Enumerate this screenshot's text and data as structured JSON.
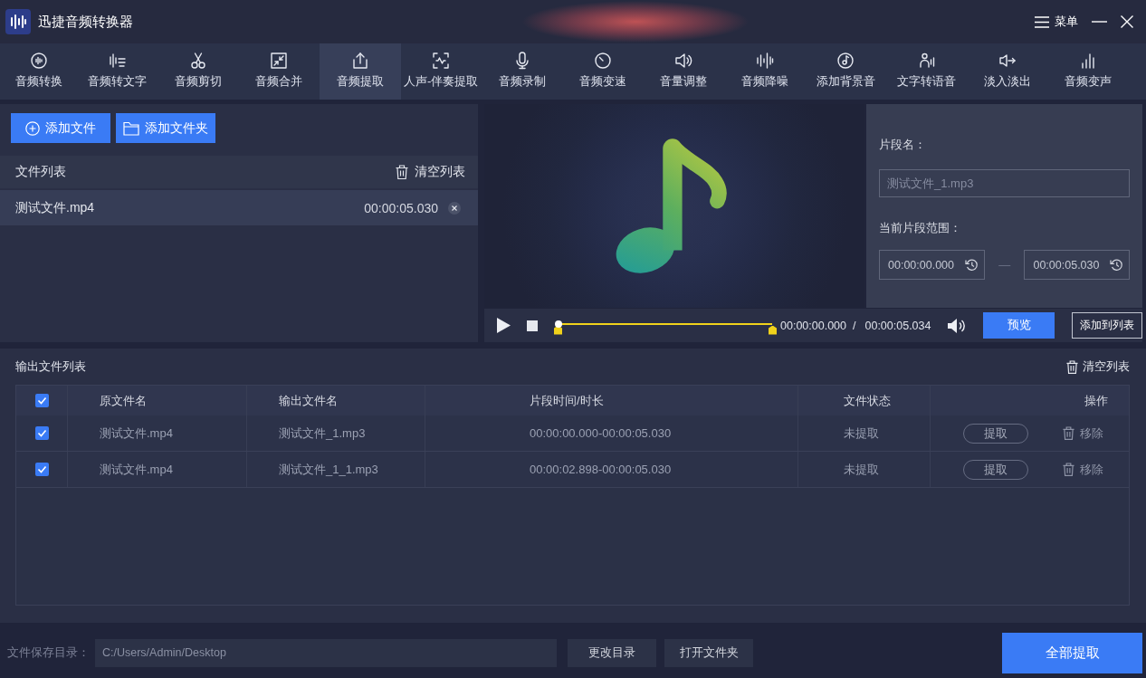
{
  "window": {
    "title": "迅捷音频转换器",
    "menu_label": "菜单"
  },
  "tabs": [
    {
      "label": "音频转换",
      "selected": false
    },
    {
      "label": "音频转文字",
      "selected": false
    },
    {
      "label": "音频剪切",
      "selected": false
    },
    {
      "label": "音频合并",
      "selected": false
    },
    {
      "label": "音频提取",
      "selected": true
    },
    {
      "label": "人声-伴奏提取",
      "selected": false
    },
    {
      "label": "音频录制",
      "selected": false
    },
    {
      "label": "音频变速",
      "selected": false
    },
    {
      "label": "音量调整",
      "selected": false
    },
    {
      "label": "音频降噪",
      "selected": false
    },
    {
      "label": "添加背景音",
      "selected": false
    },
    {
      "label": "文字转语音",
      "selected": false
    },
    {
      "label": "淡入淡出",
      "selected": false
    },
    {
      "label": "音频变声",
      "selected": false
    }
  ],
  "file_panel": {
    "add_file_button": "添加文件",
    "add_folder_button": "添加文件夹",
    "list_title": "文件列表",
    "clear_button": "清空列表",
    "files": [
      {
        "name": "测试文件.mp4",
        "duration": "00:00:05.030",
        "selected": true
      }
    ]
  },
  "clip_settings": {
    "name_label": "片段名：",
    "name_value": "测试文件_1.mp3",
    "range_label": "当前片段范围：",
    "range_start": "00:00:00.000",
    "range_separator": "—",
    "range_end": "00:00:05.030"
  },
  "player": {
    "level": 0,
    "current_time": "00:00:00.000",
    "time_separator": "/",
    "total_time": "00:00:05.034",
    "preview_button": "预览",
    "add_to_list_button": "添加到列表"
  },
  "output": {
    "title": "输出文件列表",
    "clear_button": "清空列表",
    "all_checked": true,
    "columns": [
      "原文件名",
      "输出文件名",
      "片段时间/时长",
      "文件状态",
      "操作"
    ],
    "rows": [
      {
        "checked": true,
        "source": "测试文件.mp4",
        "output": "测试文件_1.mp3",
        "segment": "00:00:00.000-00:00:05.030",
        "status": "未提取",
        "extract_button": "提取",
        "remove_button": "移除"
      },
      {
        "checked": true,
        "source": "测试文件.mp4",
        "output": "测试文件_1_1.mp3",
        "segment": "00:00:02.898-00:00:05.030",
        "status": "未提取",
        "extract_button": "提取",
        "remove_button": "移除"
      }
    ]
  },
  "footer": {
    "save_dir_label": "文件保存目录：",
    "save_dir_value": "C:/Users/Admin/Desktop",
    "change_dir_button": "更改目录",
    "open_folder_button": "打开文件夹",
    "extract_all_button": "全部提取"
  }
}
